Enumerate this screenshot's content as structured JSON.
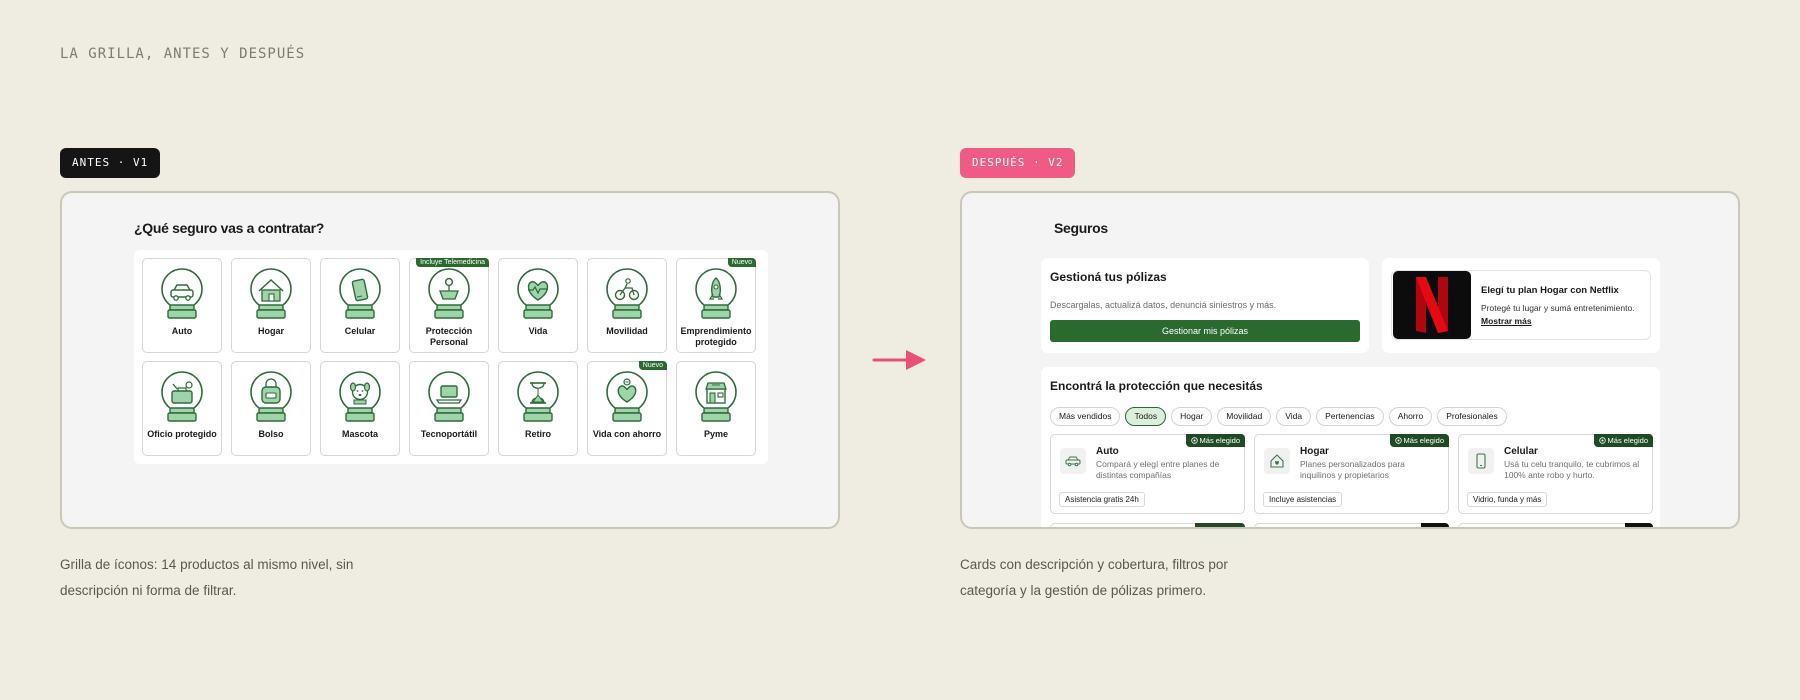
{
  "page_heading": "LA GRILLA, ANTES Y DESPUÉS",
  "before": {
    "tag": "ANTES · V1",
    "title": "¿Qué seguro vas a contratar?",
    "caption_line1": "Grilla de íconos: 14 productos al mismo nivel, sin",
    "caption_line2": "descripción ni forma de filtrar.",
    "items": [
      {
        "label": "Auto",
        "icon": "car-icon",
        "badge": ""
      },
      {
        "label": "Hogar",
        "icon": "house-icon",
        "badge": ""
      },
      {
        "label": "Celular",
        "icon": "phone-icon",
        "badge": ""
      },
      {
        "label": "Protección Personal",
        "icon": "person-icon",
        "badge": "Incluye Telemedicina"
      },
      {
        "label": "Vida",
        "icon": "heart-icon",
        "badge": ""
      },
      {
        "label": "Movilidad",
        "icon": "bicycle-icon",
        "badge": ""
      },
      {
        "label": "Emprendimiento protegido",
        "icon": "rocket-icon",
        "badge": "Nuevo"
      },
      {
        "label": "Oficio protegido",
        "icon": "tools-icon",
        "badge": ""
      },
      {
        "label": "Bolso",
        "icon": "bag-icon",
        "badge": ""
      },
      {
        "label": "Mascota",
        "icon": "pet-icon",
        "badge": ""
      },
      {
        "label": "Tecnoportátil",
        "icon": "laptop-icon",
        "badge": ""
      },
      {
        "label": "Retiro",
        "icon": "hourglass-icon",
        "badge": ""
      },
      {
        "label": "Vida con ahorro",
        "icon": "savings-heart-icon",
        "badge": "Nuevo"
      },
      {
        "label": "Pyme",
        "icon": "store-icon",
        "badge": ""
      }
    ]
  },
  "after": {
    "tag": "DESPUÉS · V2",
    "title": "Seguros",
    "caption_line1": "Cards con descripción y cobertura, filtros por",
    "caption_line2": "categoría y la gestión de pólizas primero.",
    "policies": {
      "title": "Gestioná tus pólizas",
      "description": "Descargalas, actualizá datos, denunciá siniestros y más.",
      "button": "Gestionar mis pólizas"
    },
    "promo": {
      "title": "Elegí tu plan Hogar con Netflix",
      "description": "Protegé tu lugar y sumá entretenimiento.",
      "link": "Mostrar más"
    },
    "search": {
      "title": "Encontrá la protección que necesitás",
      "filters": [
        "Más vendidos",
        "Todos",
        "Hogar",
        "Movilidad",
        "Vida",
        "Pertenencias",
        "Ahorro",
        "Profesionales"
      ],
      "active_filter": "Todos"
    },
    "cards": [
      {
        "name": "Auto",
        "icon": "car-icon",
        "description": "Compará y elegí entre planes de distintas compañías",
        "tag": "Asistencia gratis 24h",
        "badge": "Más elegido"
      },
      {
        "name": "Hogar",
        "icon": "house-heart-icon",
        "description": "Planes personalizados para inquilinos y propietarios",
        "tag": "Incluye asistencias",
        "badge": "Más elegido"
      },
      {
        "name": "Celular",
        "icon": "phone-icon",
        "description": "Usá tu celu tranquilo, te cubrimos al 100% ante robo y hurto.",
        "tag": "Vidrio, funda y más",
        "badge": "Más elegido"
      }
    ],
    "netflix_letter": "N"
  },
  "colors": {
    "background": "#efece2",
    "brand_green": "#2a6a2e",
    "accent_pink": "#ef5b84",
    "netflix_red": "#e50914"
  }
}
